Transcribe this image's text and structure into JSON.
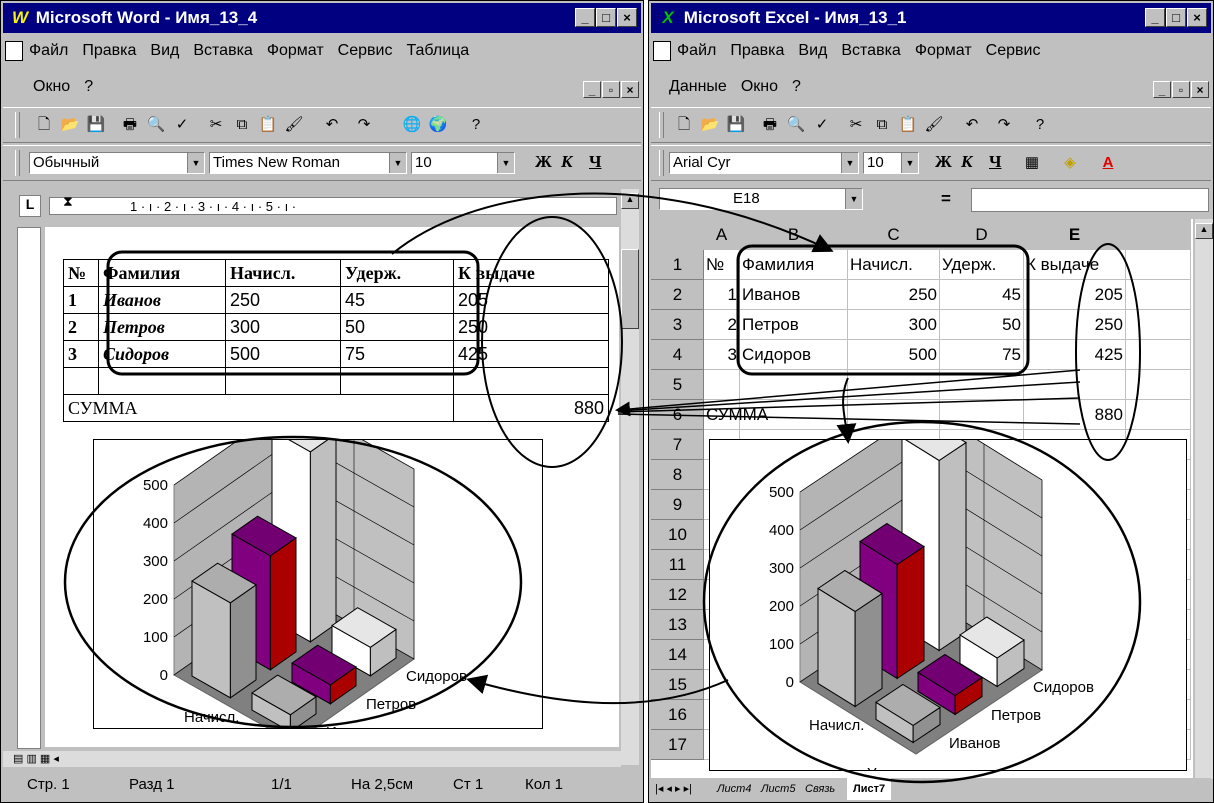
{
  "word": {
    "title": "Microsoft Word - Имя_13_4",
    "app_icon": "W",
    "menu_row1": [
      "Файл",
      "Правка",
      "Вид",
      "Вставка",
      "Формат",
      "Сервис",
      "Таблица"
    ],
    "menu_row2": [
      "Окно",
      "?"
    ],
    "style": "Обычный",
    "font": "Times New Roman",
    "size": "10",
    "format_buttons": [
      "Ж",
      "К",
      "Ч"
    ],
    "ruler": "1 · ı · 2 · ı · 3 · ı · 4 · ı · 5 · ı ·",
    "table": {
      "header": [
        "№",
        "Фамилия",
        "Начисл.",
        "Удерж.",
        "К выдаче"
      ],
      "rows": [
        [
          "1",
          "Иванов",
          "250",
          "45",
          "205"
        ],
        [
          "2",
          "Петров",
          "300",
          "50",
          "250"
        ],
        [
          "3",
          "Сидоров",
          "500",
          "75",
          "425"
        ]
      ],
      "sum_label": "СУММА",
      "sum_value": "880"
    },
    "status": {
      "page": "Стр. 1",
      "section": "Разд 1",
      "pages": "1/1",
      "at": "На 2,5см",
      "line": "Ст 1",
      "col": "Кол 1"
    }
  },
  "excel": {
    "title": "Microsoft Excel - Имя_13_1",
    "app_icon": "X",
    "menu_row1": [
      "Файл",
      "Правка",
      "Вид",
      "Вставка",
      "Формат",
      "Сервис"
    ],
    "menu_row2": [
      "Данные",
      "Окно",
      "?"
    ],
    "font": "Arial Cyr",
    "size": "10",
    "format_buttons": [
      "Ж",
      "К",
      "Ч"
    ],
    "name_box": "E18",
    "formula_eq": "=",
    "columns": [
      "A",
      "B",
      "C",
      "D",
      "E"
    ],
    "row_numbers": [
      "1",
      "2",
      "3",
      "4",
      "5",
      "6",
      "7",
      "8",
      "9",
      "10",
      "11",
      "12",
      "13",
      "14",
      "15",
      "16",
      "17"
    ],
    "cells": [
      [
        "№",
        "Фамилия",
        "Начисл.",
        "Удерж.",
        "К выдаче"
      ],
      [
        "1",
        "Иванов",
        "250",
        "45",
        "205"
      ],
      [
        "2",
        "Петров",
        "300",
        "50",
        "250"
      ],
      [
        "3",
        "Сидоров",
        "500",
        "75",
        "425"
      ],
      [
        "",
        "",
        "",
        "",
        ""
      ],
      [
        "СУММА",
        "",
        "",
        "",
        "880"
      ]
    ],
    "sheet_tabs": [
      "Лист4",
      "Лист5",
      "Связь",
      "Лист7"
    ],
    "active_tab": "Лист7"
  },
  "chart_data": [
    {
      "type": "bar",
      "subtype": "3d-column",
      "location": "word-document",
      "categories": [
        "Начисл.",
        "Удерж."
      ],
      "series": [
        {
          "name": "Иванов",
          "values": [
            250,
            45
          ],
          "color": "#c0c0c0"
        },
        {
          "name": "Петров",
          "values": [
            300,
            50
          ],
          "color": "#800080"
        },
        {
          "name": "Сидоров",
          "values": [
            500,
            75
          ],
          "color": "#ffffff"
        }
      ],
      "yticks": [
        0,
        100,
        200,
        300,
        400,
        500
      ],
      "ylim": [
        0,
        500
      ],
      "grid": true
    },
    {
      "type": "bar",
      "subtype": "3d-column",
      "location": "excel-sheet",
      "categories": [
        "Начисл.",
        "Удерж."
      ],
      "series": [
        {
          "name": "Иванов",
          "values": [
            250,
            45
          ],
          "color": "#c0c0c0"
        },
        {
          "name": "Петров",
          "values": [
            300,
            50
          ],
          "color": "#800080"
        },
        {
          "name": "Сидоров",
          "values": [
            500,
            75
          ],
          "color": "#ffffff"
        }
      ],
      "yticks": [
        0,
        100,
        200,
        300,
        400,
        500
      ],
      "ylim": [
        0,
        500
      ],
      "grid": true
    }
  ]
}
